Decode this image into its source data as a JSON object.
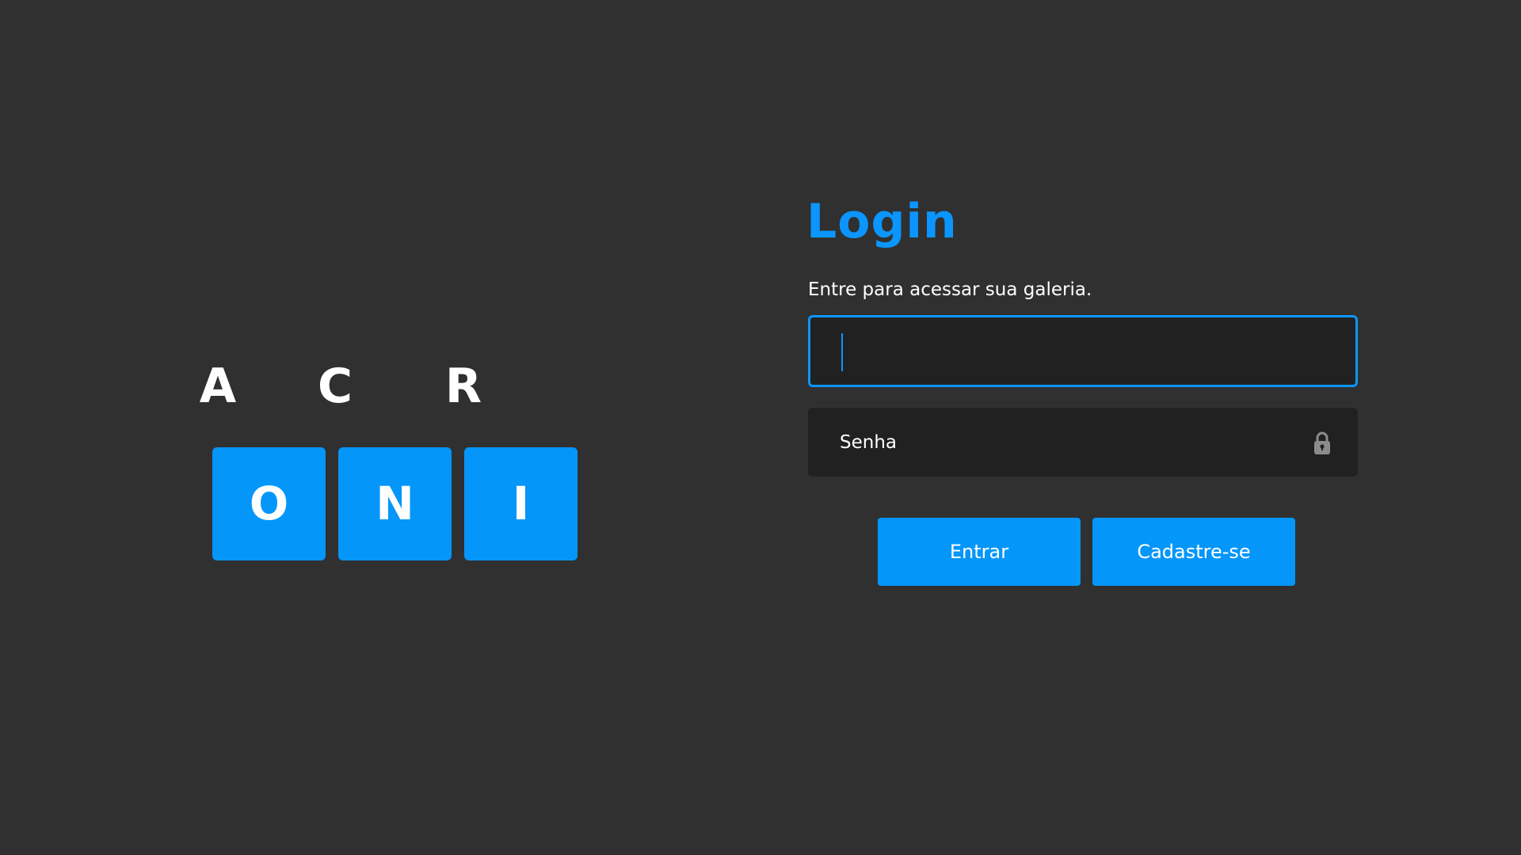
{
  "logo": {
    "top_letters": [
      "A",
      "C",
      "R"
    ],
    "tiles": [
      "O",
      "N",
      "I"
    ]
  },
  "login": {
    "title": "Login",
    "subtitle": "Entre para acessar sua galeria.",
    "username": {
      "value": "",
      "placeholder": ""
    },
    "password": {
      "value": "",
      "placeholder": "Senha",
      "icon": "lock-icon"
    },
    "buttons": {
      "enter_label": "Entrar",
      "signup_label": "Cadastre-se"
    }
  },
  "colors": {
    "background": "#303030",
    "accent": "#0596f9",
    "title": "#0b96ff",
    "field_background": "#212121",
    "text": "#ffffff"
  }
}
